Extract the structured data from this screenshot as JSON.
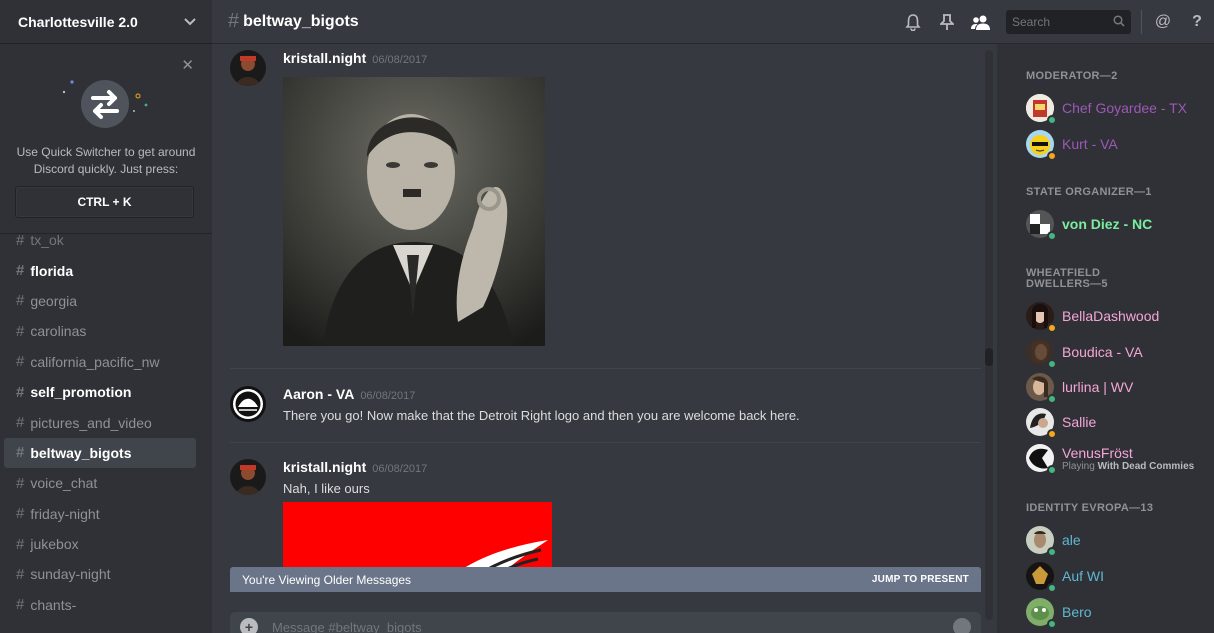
{
  "server": {
    "name": "Charlottesville 2.0"
  },
  "switcher": {
    "description_line1": "Use Quick Switcher to get around",
    "description_line2": "Discord quickly. Just press:",
    "shortcut": "CTRL + K"
  },
  "channels": [
    {
      "name": "tx_ok",
      "state": "faded"
    },
    {
      "name": "florida",
      "state": "unread"
    },
    {
      "name": "georgia",
      "state": "normal"
    },
    {
      "name": "carolinas",
      "state": "normal"
    },
    {
      "name": "california_pacific_nw",
      "state": "normal"
    },
    {
      "name": "self_promotion",
      "state": "unread"
    },
    {
      "name": "pictures_and_video",
      "state": "normal"
    },
    {
      "name": "beltway_bigots",
      "state": "active"
    },
    {
      "name": "voice_chat",
      "state": "normal"
    },
    {
      "name": "friday-night",
      "state": "normal"
    },
    {
      "name": "jukebox",
      "state": "normal"
    },
    {
      "name": "sunday-night",
      "state": "normal"
    },
    {
      "name": "chants-",
      "state": "normal"
    }
  ],
  "header": {
    "channel": "beltway_bigots",
    "search_placeholder": "Search",
    "help": "?",
    "mention": "@"
  },
  "messages": [
    {
      "author": "kristall.night",
      "timestamp": "06/08/2017",
      "text": ""
    },
    {
      "author": "Aaron - VA",
      "timestamp": "06/08/2017",
      "text": "There you go! Now make that the Detroit Right logo and then you are welcome back here."
    },
    {
      "author": "kristall.night",
      "timestamp": "06/08/2017",
      "text": "Nah, I like ours"
    }
  ],
  "older_bar": {
    "label": "You're Viewing Older Messages",
    "jump": "JUMP TO PRESENT"
  },
  "composer": {
    "placeholder": "Message #beltway_bigots"
  },
  "member_groups": [
    {
      "title": "MODERATOR—2"
    },
    {
      "title": "STATE ORGANIZER—1"
    },
    {
      "title_line1": "WHEATFIELD",
      "title_line2": "DWELLERS—5"
    },
    {
      "title": "IDENTITY EVROPA—13"
    }
  ],
  "members": [
    {
      "name": "Chef Goyardee - TX",
      "color": "#9b59b6",
      "status": "#43b581"
    },
    {
      "name": "Kurt - VA",
      "color": "#9b59b6",
      "status": "#faa61a"
    },
    {
      "name": "von Diez - NC",
      "color": "#7bed9f",
      "status": "#43b581"
    },
    {
      "name": "BellaDashwood",
      "color": "#f5a6d6",
      "status": "#faa61a"
    },
    {
      "name": "Boudica - VA",
      "color": "#f5a6d6",
      "status": "#43b581"
    },
    {
      "name": "lurlina | WV",
      "color": "#f5a6d6",
      "status": "#43b581"
    },
    {
      "name": "Sallie",
      "color": "#f5a6d6",
      "status": "#faa61a"
    },
    {
      "name": "VenusFröst",
      "color": "#f5a6d6",
      "status": "#43b581",
      "activity_prefix": "Playing",
      "activity": "With Dead Commies"
    },
    {
      "name": "ale",
      "color": "#5fb8d1",
      "status": "#43b581"
    },
    {
      "name": "Auf WI",
      "color": "#5fb8d1",
      "status": "#43b581"
    },
    {
      "name": "Bero",
      "color": "#5fb8d1",
      "status": "#43b581"
    }
  ]
}
